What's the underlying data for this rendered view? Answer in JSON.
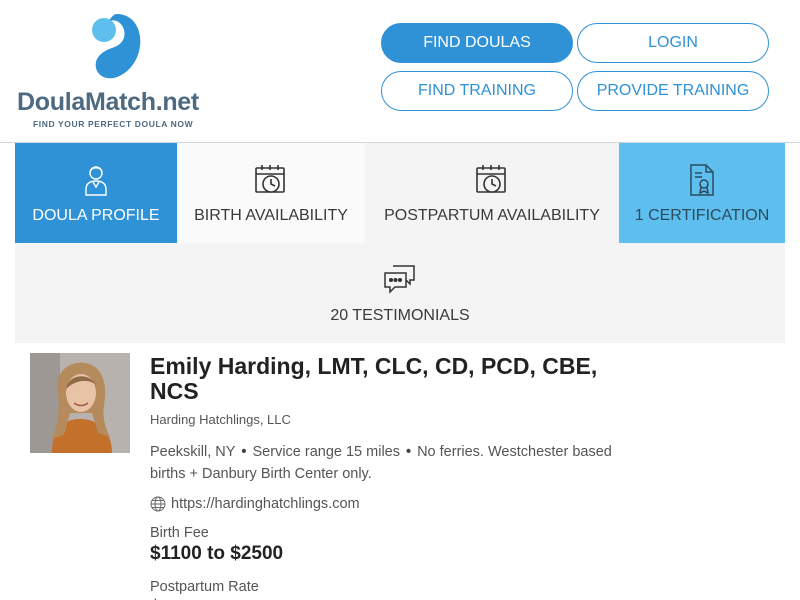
{
  "brand": {
    "name_part1": "Doula",
    "name_part2": "Match",
    "name_part3": ".net",
    "tagline": "FIND YOUR PERFECT DOULA NOW",
    "colors": {
      "primary": "#2f92d6",
      "light": "#5ebfee",
      "text": "#4d6a80"
    }
  },
  "nav": {
    "find_doulas": "FIND DOULAS",
    "login": "LOGIN",
    "find_training": "FIND TRAINING",
    "provide_training": "PROVIDE TRAINING"
  },
  "tabs": [
    {
      "label": "DOULA PROFILE",
      "icon": "doula-person-icon"
    },
    {
      "label": "BIRTH AVAILABILITY",
      "icon": "calendar-clock-icon"
    },
    {
      "label": "POSTPARTUM AVAILABILITY",
      "icon": "calendar-clock-icon"
    },
    {
      "label": "1 CERTIFICATION",
      "icon": "certificate-icon"
    },
    {
      "label": "20 TESTIMONIALS",
      "icon": "chat-bubbles-icon"
    }
  ],
  "profile": {
    "name": "Emily Harding, LMT, CLC, CD, PCD, CBE, NCS",
    "company": "Harding Hatchlings, LLC",
    "location": "Peekskill, NY",
    "service_range": "Service range 15 miles",
    "notes": "No ferries. Westchester based births + Danbury Birth Center only.",
    "website": "https://hardinghatchlings.com",
    "birth_fee_label": "Birth Fee",
    "birth_fee_value": "$1100 to $2500",
    "postpartum_label": "Postpartum Rate",
    "postpartum_value": "$"
  }
}
